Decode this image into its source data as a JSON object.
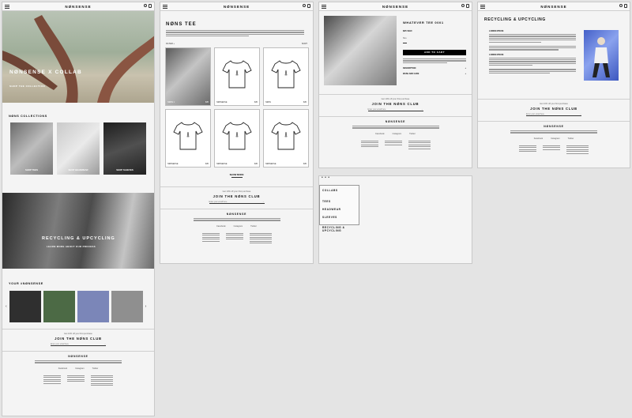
{
  "brand": "NØNSENSE",
  "home": {
    "hero_title": "NØNSENSE X COLLAB",
    "hero_cta": "SHOP THE COLLECTION",
    "collections_title": "NØNS COLLECTIONS",
    "collections": [
      {
        "label": "SHOP TEES"
      },
      {
        "label": "SHOP HEADWEAR"
      },
      {
        "label": "SHOP SLEEVES"
      }
    ],
    "recycling_title": "RECYCLING & UPCYCLING",
    "recycling_cta": "LEARN MORE ABOUT OUR PROCESS",
    "your_title": "YOUR #NØNSENSE",
    "swatches": [
      "#2f2f2f",
      "#4c6a45",
      "#7b86b8",
      "#8f8f8f"
    ]
  },
  "club": {
    "small": "Get 10% off your first purchase",
    "title": "JOIN THE NØNS CLUB",
    "placeholder": "Enter your email here"
  },
  "footer": {
    "brand": "NØNSENSE",
    "social": [
      "Facebook",
      "Instagram",
      "Twitter"
    ]
  },
  "listing": {
    "title": "NØNS TEE",
    "filter": "FILTER +",
    "sort": "SORT",
    "products": [
      {
        "name": "NØNS 1",
        "price": "$35"
      },
      {
        "name": "NØNSENSE",
        "price": "$35"
      },
      {
        "name": "NØNS",
        "price": "$35"
      },
      {
        "name": "NØNSENSE",
        "price": "$35"
      },
      {
        "name": "NØNSENSE",
        "price": "$35"
      },
      {
        "name": "NØNSENSE",
        "price": "$35"
      }
    ],
    "show_more": "SHOW MORE"
  },
  "product": {
    "title": "WHATEVER TEE 0001",
    "price": "$35 SGD",
    "size_label": "Size",
    "add_to_cart": "ADD TO CART",
    "description_label": "DESCRIPTION",
    "care_label": "WASH AND CARE"
  },
  "menu": {
    "items": [
      "COLLABS",
      "TEES",
      "HEADWEAR",
      "SLEEVES",
      "RECYCLING & UPCYCLING"
    ]
  },
  "recycling": {
    "title": "RECYCLING & UPCYCLING",
    "sub1": "LOREM IPSUM",
    "sub2": "LOREM IPSUM"
  }
}
